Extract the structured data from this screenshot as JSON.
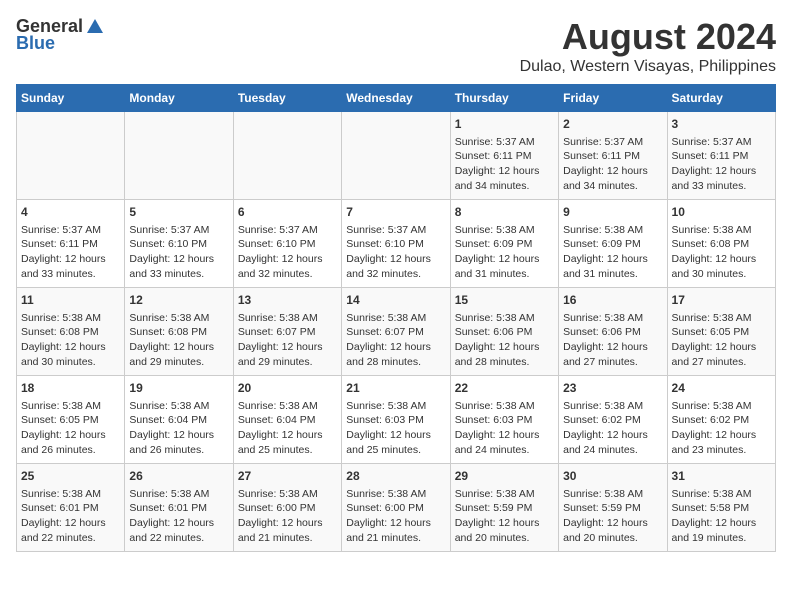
{
  "logo": {
    "general": "General",
    "blue": "Blue"
  },
  "title": "August 2024",
  "subtitle": "Dulao, Western Visayas, Philippines",
  "headers": [
    "Sunday",
    "Monday",
    "Tuesday",
    "Wednesday",
    "Thursday",
    "Friday",
    "Saturday"
  ],
  "rows": [
    [
      {
        "day": "",
        "content": ""
      },
      {
        "day": "",
        "content": ""
      },
      {
        "day": "",
        "content": ""
      },
      {
        "day": "",
        "content": ""
      },
      {
        "day": "1",
        "content": "Sunrise: 5:37 AM\nSunset: 6:11 PM\nDaylight: 12 hours\nand 34 minutes."
      },
      {
        "day": "2",
        "content": "Sunrise: 5:37 AM\nSunset: 6:11 PM\nDaylight: 12 hours\nand 34 minutes."
      },
      {
        "day": "3",
        "content": "Sunrise: 5:37 AM\nSunset: 6:11 PM\nDaylight: 12 hours\nand 33 minutes."
      }
    ],
    [
      {
        "day": "4",
        "content": "Sunrise: 5:37 AM\nSunset: 6:11 PM\nDaylight: 12 hours\nand 33 minutes."
      },
      {
        "day": "5",
        "content": "Sunrise: 5:37 AM\nSunset: 6:10 PM\nDaylight: 12 hours\nand 33 minutes."
      },
      {
        "day": "6",
        "content": "Sunrise: 5:37 AM\nSunset: 6:10 PM\nDaylight: 12 hours\nand 32 minutes."
      },
      {
        "day": "7",
        "content": "Sunrise: 5:37 AM\nSunset: 6:10 PM\nDaylight: 12 hours\nand 32 minutes."
      },
      {
        "day": "8",
        "content": "Sunrise: 5:38 AM\nSunset: 6:09 PM\nDaylight: 12 hours\nand 31 minutes."
      },
      {
        "day": "9",
        "content": "Sunrise: 5:38 AM\nSunset: 6:09 PM\nDaylight: 12 hours\nand 31 minutes."
      },
      {
        "day": "10",
        "content": "Sunrise: 5:38 AM\nSunset: 6:08 PM\nDaylight: 12 hours\nand 30 minutes."
      }
    ],
    [
      {
        "day": "11",
        "content": "Sunrise: 5:38 AM\nSunset: 6:08 PM\nDaylight: 12 hours\nand 30 minutes."
      },
      {
        "day": "12",
        "content": "Sunrise: 5:38 AM\nSunset: 6:08 PM\nDaylight: 12 hours\nand 29 minutes."
      },
      {
        "day": "13",
        "content": "Sunrise: 5:38 AM\nSunset: 6:07 PM\nDaylight: 12 hours\nand 29 minutes."
      },
      {
        "day": "14",
        "content": "Sunrise: 5:38 AM\nSunset: 6:07 PM\nDaylight: 12 hours\nand 28 minutes."
      },
      {
        "day": "15",
        "content": "Sunrise: 5:38 AM\nSunset: 6:06 PM\nDaylight: 12 hours\nand 28 minutes."
      },
      {
        "day": "16",
        "content": "Sunrise: 5:38 AM\nSunset: 6:06 PM\nDaylight: 12 hours\nand 27 minutes."
      },
      {
        "day": "17",
        "content": "Sunrise: 5:38 AM\nSunset: 6:05 PM\nDaylight: 12 hours\nand 27 minutes."
      }
    ],
    [
      {
        "day": "18",
        "content": "Sunrise: 5:38 AM\nSunset: 6:05 PM\nDaylight: 12 hours\nand 26 minutes."
      },
      {
        "day": "19",
        "content": "Sunrise: 5:38 AM\nSunset: 6:04 PM\nDaylight: 12 hours\nand 26 minutes."
      },
      {
        "day": "20",
        "content": "Sunrise: 5:38 AM\nSunset: 6:04 PM\nDaylight: 12 hours\nand 25 minutes."
      },
      {
        "day": "21",
        "content": "Sunrise: 5:38 AM\nSunset: 6:03 PM\nDaylight: 12 hours\nand 25 minutes."
      },
      {
        "day": "22",
        "content": "Sunrise: 5:38 AM\nSunset: 6:03 PM\nDaylight: 12 hours\nand 24 minutes."
      },
      {
        "day": "23",
        "content": "Sunrise: 5:38 AM\nSunset: 6:02 PM\nDaylight: 12 hours\nand 24 minutes."
      },
      {
        "day": "24",
        "content": "Sunrise: 5:38 AM\nSunset: 6:02 PM\nDaylight: 12 hours\nand 23 minutes."
      }
    ],
    [
      {
        "day": "25",
        "content": "Sunrise: 5:38 AM\nSunset: 6:01 PM\nDaylight: 12 hours\nand 22 minutes."
      },
      {
        "day": "26",
        "content": "Sunrise: 5:38 AM\nSunset: 6:01 PM\nDaylight: 12 hours\nand 22 minutes."
      },
      {
        "day": "27",
        "content": "Sunrise: 5:38 AM\nSunset: 6:00 PM\nDaylight: 12 hours\nand 21 minutes."
      },
      {
        "day": "28",
        "content": "Sunrise: 5:38 AM\nSunset: 6:00 PM\nDaylight: 12 hours\nand 21 minutes."
      },
      {
        "day": "29",
        "content": "Sunrise: 5:38 AM\nSunset: 5:59 PM\nDaylight: 12 hours\nand 20 minutes."
      },
      {
        "day": "30",
        "content": "Sunrise: 5:38 AM\nSunset: 5:59 PM\nDaylight: 12 hours\nand 20 minutes."
      },
      {
        "day": "31",
        "content": "Sunrise: 5:38 AM\nSunset: 5:58 PM\nDaylight: 12 hours\nand 19 minutes."
      }
    ]
  ]
}
